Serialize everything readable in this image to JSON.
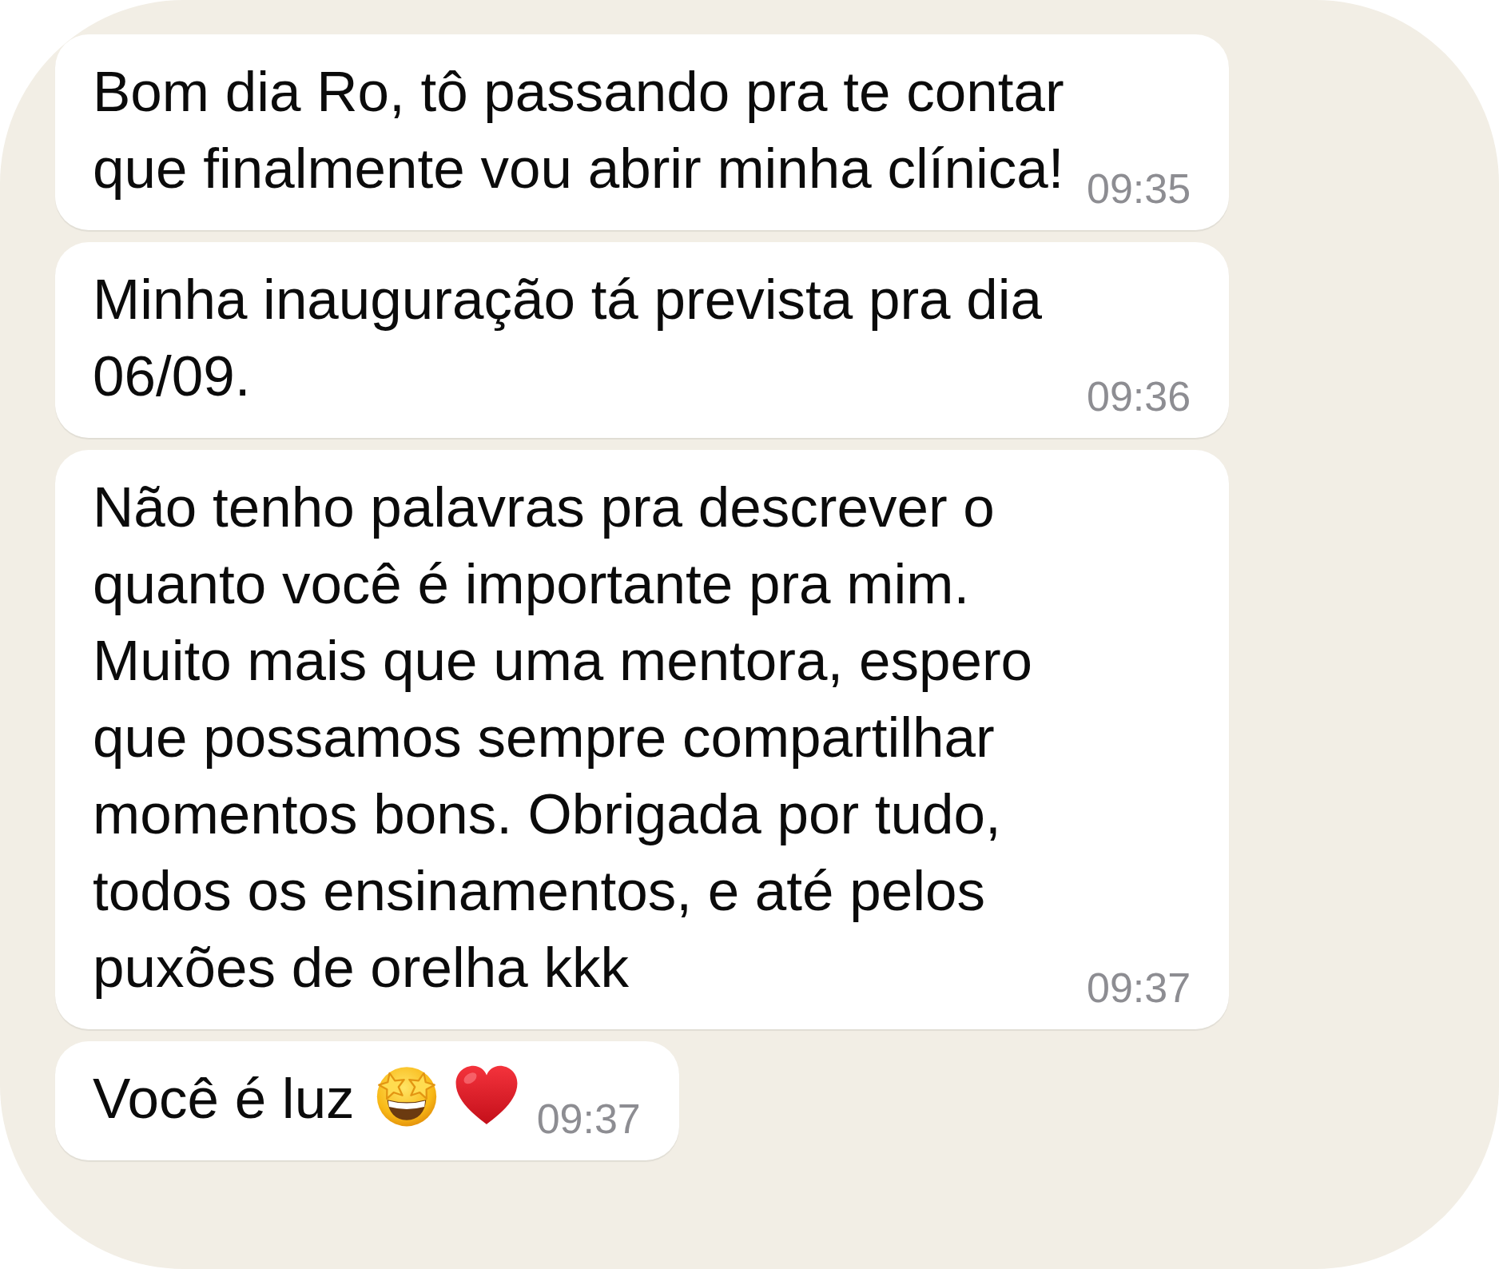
{
  "messages": [
    {
      "text": "Bom dia Ro, tô passando pra te contar que finalmente vou abrir minha clínica!",
      "time": "09:35"
    },
    {
      "text": "Minha inauguração tá prevista pra dia 06/09.",
      "time": "09:36"
    },
    {
      "text": "Não tenho palavras pra descrever o quanto você é importante pra mim. Muito mais que uma mentora, espero que possamos sempre compartilhar momentos bons. Obrigada por tudo, todos os ensinamentos, e até pelos puxões de orelha kkk",
      "time": "09:37"
    },
    {
      "text": "Você é luz",
      "emoji": [
        {
          "kind": "star-struck"
        },
        {
          "kind": "heart"
        }
      ],
      "time": "09:37"
    }
  ]
}
